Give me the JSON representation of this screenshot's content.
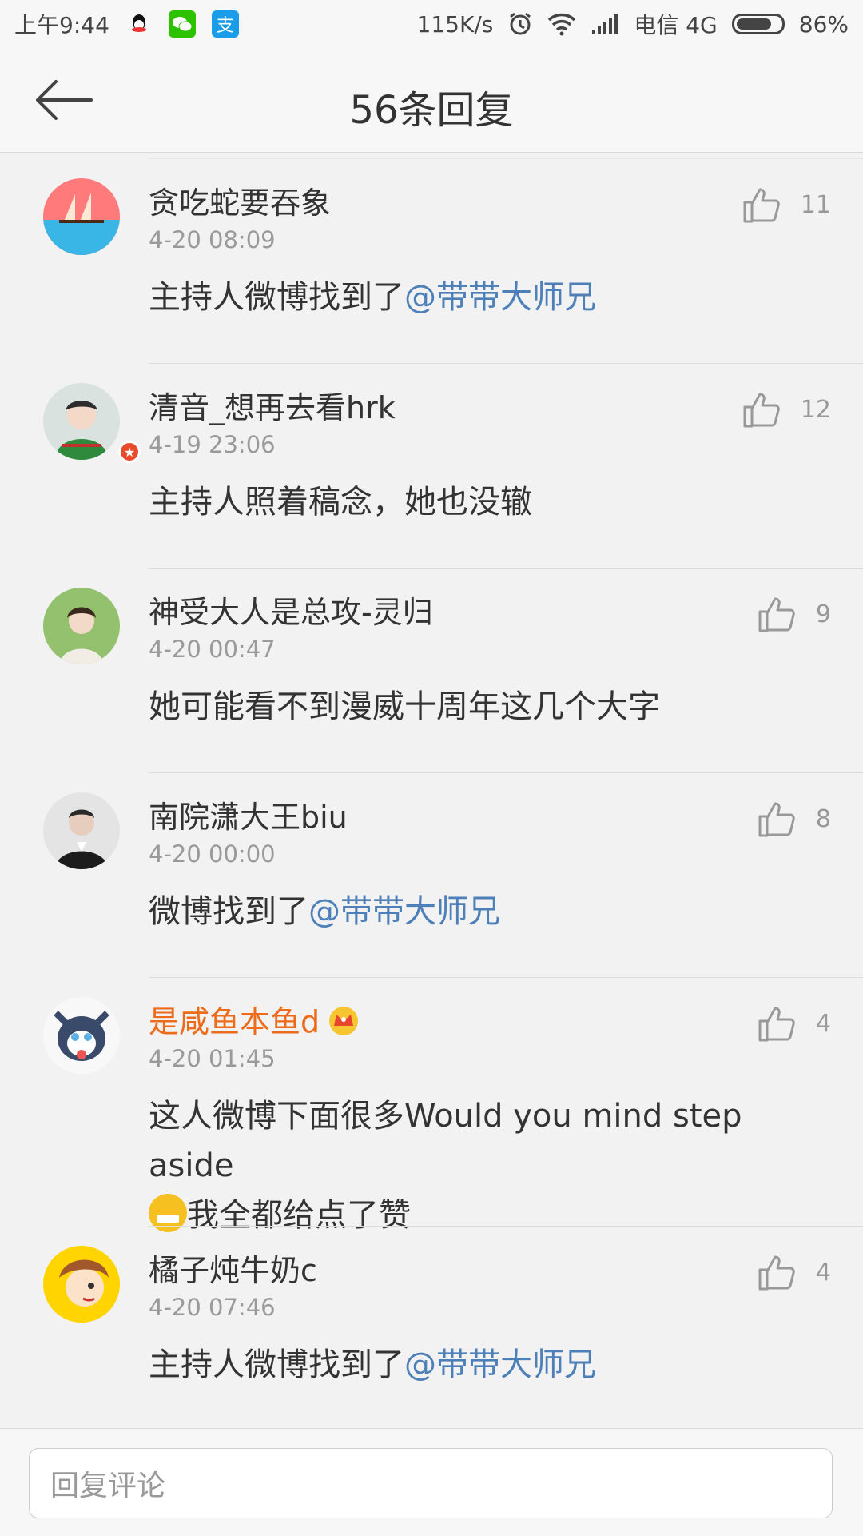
{
  "status_bar": {
    "time": "上午9:44",
    "speed": "115K/s",
    "carrier": "电信 4G",
    "battery": "86%",
    "battery_level": 0.86,
    "apps": [
      "qq-icon",
      "wechat-icon",
      "alipay-icon"
    ]
  },
  "header": {
    "title": "56条回复",
    "back_icon": "back-arrow-icon"
  },
  "comments": [
    {
      "name": "贪吃蛇要吞象",
      "time": "4-20 08:09",
      "likes": "11",
      "text": "主持人微博找到了",
      "mention": "@带带大师兄",
      "avatar_colors": [
        "#ff6f6f",
        "#37b6e8"
      ],
      "vip": false
    },
    {
      "name": "清音_想再去看hrk",
      "time": "4-19 23:06",
      "likes": "12",
      "text": "主持人照着稿念，她也没辙",
      "mention": "",
      "avatar_colors": [
        "#cfd8d6",
        "#2e8b3e"
      ],
      "vip": false,
      "badge": true
    },
    {
      "name": "神受大人是总攻-灵归",
      "time": "4-20 00:47",
      "likes": "9",
      "text": "她可能看不到漫威十周年这几个大字",
      "mention": "",
      "avatar_colors": [
        "#8fbf6a",
        "#e9dcc8"
      ],
      "vip": false
    },
    {
      "name": "南院潇大王biu",
      "time": "4-20 00:00",
      "likes": "8",
      "text": "微博找到了",
      "mention": "@带带大师兄",
      "avatar_colors": [
        "#e7e7e7",
        "#1e1e1e"
      ],
      "vip": false
    },
    {
      "name": "是咸鱼本鱼d",
      "time": "4-20 01:45",
      "likes": "4",
      "text": "这人微博下面很多Would you mind step aside",
      "text2": "我全都给点了赞",
      "mention": "",
      "avatar_colors": [
        "#ffffff",
        "#3a4a6a"
      ],
      "vip": true
    },
    {
      "name": "橘子炖牛奶c",
      "time": "4-20 07:46",
      "likes": "4",
      "text": "主持人微博找到了",
      "mention": "@带带大师兄",
      "avatar_colors": [
        "#ffd400",
        "#a35a2a"
      ],
      "vip": false
    }
  ],
  "reply": {
    "placeholder": "回复评论"
  },
  "colors": {
    "mention": "#4d7fb8",
    "vip_name": "#ec6c1b",
    "background": "#f2f2f2"
  }
}
